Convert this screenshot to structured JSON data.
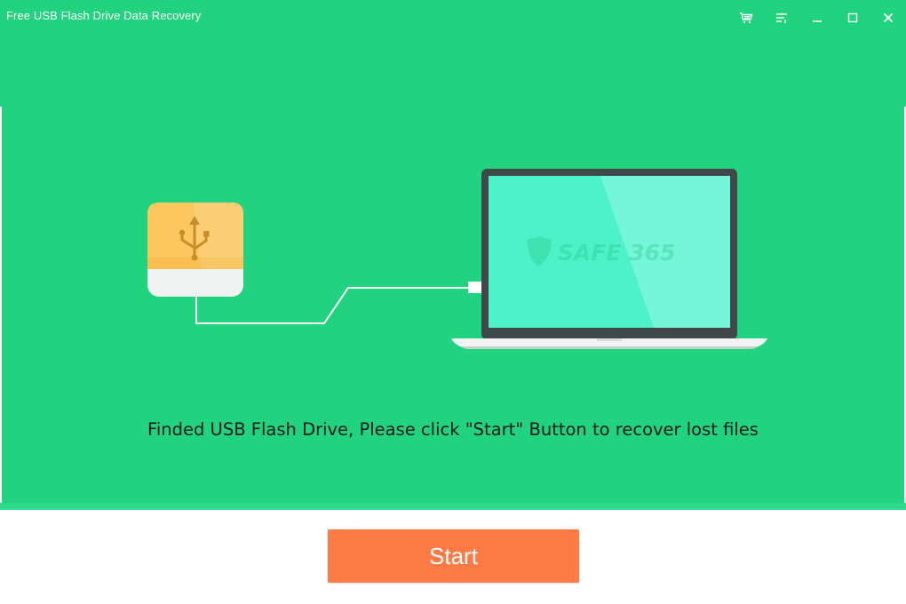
{
  "window": {
    "title": "Free USB Flash Drive Data Recovery",
    "controls": [
      {
        "name": "store-icon"
      },
      {
        "name": "menu-icon"
      },
      {
        "name": "minimize-icon"
      },
      {
        "name": "maximize-icon"
      },
      {
        "name": "close-icon"
      }
    ]
  },
  "illustration": {
    "watermark": "SAFE 365"
  },
  "main": {
    "message": "Finded USB Flash Drive, Please click \"Start\" Button to recover lost files"
  },
  "footer": {
    "start_label": "Start"
  },
  "colors": {
    "header_green": "#21d27f",
    "start_orange": "#ff7b46",
    "usb_yellow": "#fcc75f",
    "screen_teal": "#4ef2c9"
  }
}
